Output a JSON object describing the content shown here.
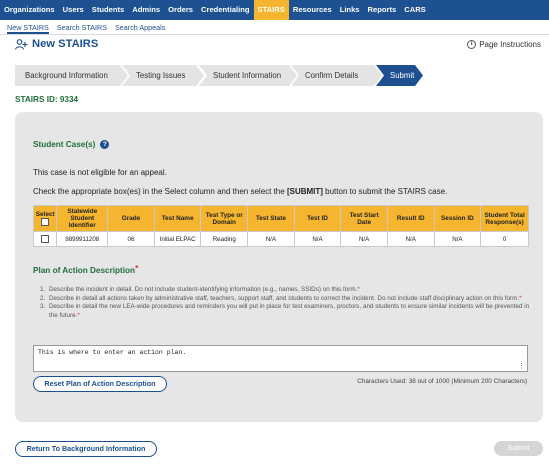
{
  "topnav": {
    "items": [
      "Organizations",
      "Users",
      "Students",
      "Admins",
      "Orders",
      "Credentialing",
      "STAIRS",
      "Resources",
      "Links",
      "Reports",
      "CARS"
    ],
    "active_index": 6
  },
  "subnav": {
    "items": [
      "New STAIRS",
      "Search STAIRS",
      "Search Appeals"
    ],
    "active_index": 0
  },
  "page": {
    "title": "New STAIRS",
    "instructions_link": "Page Instructions",
    "stairs_id": "STAIRS ID: 9334"
  },
  "steps": [
    "Background Information",
    "Testing Issues",
    "Student Information",
    "Confirm Details",
    "Submit"
  ],
  "student_cases": {
    "title": "Student Case(s)",
    "help": "?",
    "appeal_note": "This case is not eligible for an appeal.",
    "instruction_pre": "Check the appropriate box(es) in the Select column and then select the ",
    "instruction_bold": "[SUBMIT]",
    "instruction_post": " button to submit the STAIRS case.",
    "columns": [
      "Select",
      "Statewide Student Identifier",
      "Grade",
      "Test Name",
      "Test Type or Domain",
      "Test State",
      "Test ID",
      "Test Start Date",
      "Result ID",
      "Session ID",
      "Student Total Response(s)"
    ],
    "rows": [
      [
        "",
        "9899911208",
        "06",
        "Initial ELPAC",
        "Reading",
        "N/A",
        "N/A",
        "N/A",
        "N/A",
        "N/A",
        "0"
      ]
    ]
  },
  "plan": {
    "title": "Plan of Action Description",
    "required_mark": "*",
    "items": [
      "Describe the incident in detail. Do not include student-identifying information (e.g., names, SSIDs) on this form.",
      "Describe in detail all actions taken by administrative staff, teachers, support staff, and students to correct the incident. Do not include staff disciplinary action on this form.",
      "Describe in detail the new LEA-wide procedures and reminders you will put in place for test examiners, proctors, and students to ensure similar incidents will be prevented in the future."
    ],
    "textarea_value": "This is where to enter an action plan.",
    "reset_label": "Reset Plan of Action Description",
    "chars_used": "Characters Used: 38 out of 1000 (Minimum 200 Characters)"
  },
  "footer": {
    "back_label": "Return To Background Information",
    "submit_label": "Submit"
  }
}
